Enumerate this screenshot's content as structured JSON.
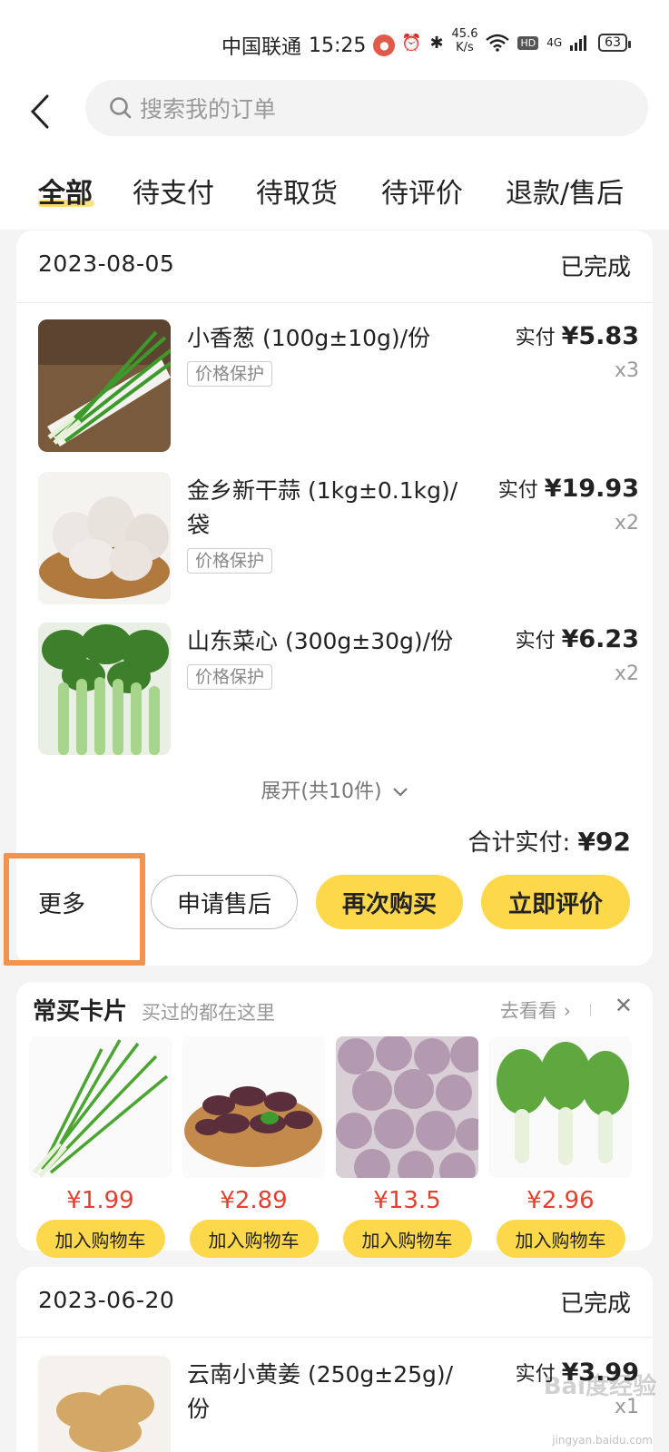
{
  "status_bar": {
    "carrier": "中国联通",
    "time": "15:25",
    "speed_value": "45.6",
    "speed_unit": "K/s",
    "network": "4G",
    "hd": "HD",
    "battery": "63"
  },
  "search": {
    "placeholder": "搜索我的订单"
  },
  "tabs": [
    {
      "label": "全部",
      "active": true
    },
    {
      "label": "待支付"
    },
    {
      "label": "待取货"
    },
    {
      "label": "待评价"
    },
    {
      "label": "退款/售后"
    }
  ],
  "order1": {
    "date": "2023-08-05",
    "status": "已完成",
    "items": [
      {
        "name": "小香葱 (100g±10g)/份",
        "tag": "价格保护",
        "paid_label": "实付",
        "amount": "¥5.83",
        "qty": "x3"
      },
      {
        "name": "金乡新干蒜 (1kg±0.1kg)/袋",
        "tag": "价格保护",
        "paid_label": "实付",
        "amount": "¥19.93",
        "qty": "x2"
      },
      {
        "name": "山东菜心 (300g±30g)/份",
        "tag": "价格保护",
        "paid_label": "实付",
        "amount": "¥6.23",
        "qty": "x2"
      }
    ],
    "expand": "展开(共10件)",
    "total_label": "合计实付:",
    "total_amount": "¥92",
    "actions": {
      "more": "更多",
      "aftersale": "申请售后",
      "rebuy": "再次购买",
      "review": "立即评价"
    }
  },
  "freq": {
    "title": "常买卡片",
    "subtitle": "买过的都在这里",
    "link": "去看看",
    "close": "✕",
    "products": [
      {
        "price": "¥1.99",
        "button": "加入购物车"
      },
      {
        "price": "¥2.89",
        "button": "加入购物车"
      },
      {
        "price": "¥13.5",
        "button": "加入购物车"
      },
      {
        "price": "¥2.96",
        "button": "加入购物车"
      }
    ]
  },
  "order2": {
    "date": "2023-06-20",
    "status": "已完成",
    "item": {
      "name": "云南小黄姜 (250g±25g)/份",
      "paid_label": "实付",
      "amount": "¥3.99",
      "qty": "x1"
    }
  },
  "watermark": {
    "text": "Bai度经验",
    "sub": "jingyan.baidu.com"
  },
  "colors": {
    "accent_yellow": "#fdd84a",
    "price_red": "#e0422f",
    "highlight_orange": "#f0944e"
  }
}
